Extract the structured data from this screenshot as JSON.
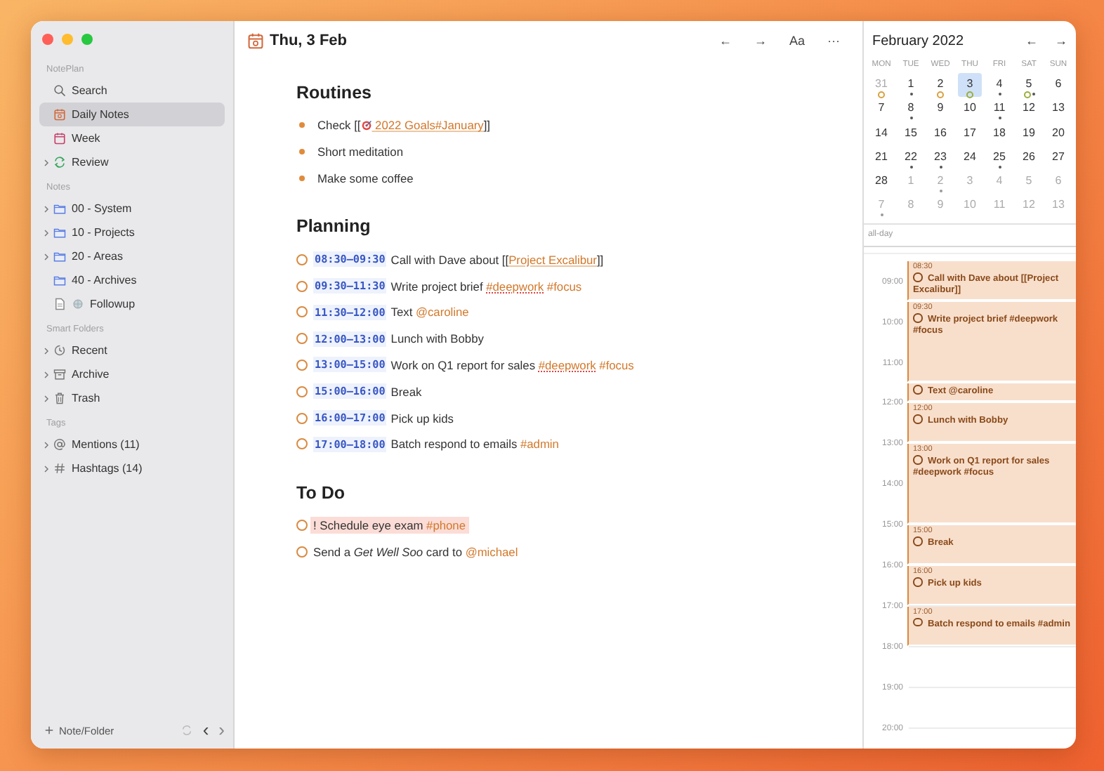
{
  "sidebar": {
    "sections": [
      {
        "heading": "NotePlan",
        "items": [
          {
            "label": "Search",
            "expandable": false,
            "selected": false
          },
          {
            "label": "Daily Notes",
            "expandable": false,
            "selected": true
          },
          {
            "label": "Week",
            "expandable": false,
            "selected": false
          },
          {
            "label": "Review",
            "expandable": true,
            "selected": false
          }
        ]
      },
      {
        "heading": "Notes",
        "items": [
          {
            "label": "00 - System",
            "expandable": true,
            "selected": false
          },
          {
            "label": "10 - Projects",
            "expandable": true,
            "selected": false
          },
          {
            "label": "20 - Areas",
            "expandable": true,
            "selected": false
          },
          {
            "label": "40 - Archives",
            "expandable": false,
            "selected": false
          },
          {
            "label": "Followup",
            "expandable": false,
            "selected": false
          }
        ]
      },
      {
        "heading": "Smart Folders",
        "items": [
          {
            "label": "Recent",
            "expandable": true,
            "selected": false
          },
          {
            "label": "Archive",
            "expandable": true,
            "selected": false
          },
          {
            "label": "Trash",
            "expandable": true,
            "selected": false
          }
        ]
      },
      {
        "heading": "Tags",
        "items": [
          {
            "label": "Mentions (11)",
            "expandable": true,
            "selected": false
          },
          {
            "label": "Hashtags (14)",
            "expandable": true,
            "selected": false
          }
        ]
      }
    ],
    "footer": {
      "add_label": "Note/Folder",
      "back": "‹",
      "forward": "›"
    }
  },
  "note": {
    "title": "Thu, 3 Feb",
    "toolbar": [
      "←",
      "→",
      "Aa",
      "···"
    ],
    "sections": [
      {
        "heading": "Routines",
        "items": [
          {
            "kind": "bullet",
            "segments": [
              {
                "kind": "plain",
                "text": "Check [["
              },
              {
                "kind": "icon"
              },
              {
                "kind": "link",
                "text": " 2022 Goals#January"
              },
              {
                "kind": "plain",
                "text": "]]"
              }
            ]
          },
          {
            "kind": "bullet",
            "segments": [
              {
                "kind": "plain",
                "text": "Short meditation"
              }
            ]
          },
          {
            "kind": "bullet",
            "segments": [
              {
                "kind": "plain",
                "text": "Make some coffee"
              }
            ]
          }
        ]
      },
      {
        "heading": "Planning",
        "items": [
          {
            "kind": "task",
            "checked": false,
            "time": "08:30–09:30",
            "segments": [
              {
                "kind": "plain",
                "text": "Call with Dave about [["
              },
              {
                "kind": "link",
                "text": "Project Excalibur"
              },
              {
                "kind": "plain",
                "text": "]]"
              }
            ]
          },
          {
            "kind": "task",
            "checked": false,
            "time": "09:30–11:30",
            "segments": [
              {
                "kind": "plain",
                "text": "Write project brief "
              },
              {
                "kind": "tag-spell",
                "text": "#deepwork"
              },
              {
                "kind": "tag",
                "text": " #focus"
              }
            ]
          },
          {
            "kind": "task",
            "checked": false,
            "time": "11:30–12:00",
            "segments": [
              {
                "kind": "plain",
                "text": "Text "
              },
              {
                "kind": "tag",
                "text": "@caroline"
              }
            ]
          },
          {
            "kind": "task",
            "checked": false,
            "time": "12:00–13:00",
            "segments": [
              {
                "kind": "plain",
                "text": "Lunch with Bobby"
              }
            ]
          },
          {
            "kind": "task",
            "checked": false,
            "time": "13:00–15:00",
            "segments": [
              {
                "kind": "plain",
                "text": "Work on Q1 report for sales "
              },
              {
                "kind": "tag-spell",
                "text": "#deepwork"
              },
              {
                "kind": "tag",
                "text": " #focus"
              }
            ]
          },
          {
            "kind": "task",
            "checked": false,
            "time": "15:00–16:00",
            "segments": [
              {
                "kind": "plain",
                "text": "Break"
              }
            ]
          },
          {
            "kind": "task",
            "checked": false,
            "time": "16:00–17:00",
            "segments": [
              {
                "kind": "plain",
                "text": "Pick up kids"
              }
            ]
          },
          {
            "kind": "task",
            "checked": false,
            "time": "17:00–18:00",
            "segments": [
              {
                "kind": "plain",
                "text": "Batch respond to emails "
              },
              {
                "kind": "tag",
                "text": "#admin"
              }
            ]
          }
        ]
      },
      {
        "heading": "To Do",
        "items": [
          {
            "kind": "task",
            "checked": false,
            "priority": true,
            "segments": [
              {
                "kind": "plain",
                "text": "! Schedule eye exam "
              },
              {
                "kind": "tag",
                "text": "#phone"
              }
            ]
          },
          {
            "kind": "task",
            "checked": false,
            "priority": false,
            "segments": [
              {
                "kind": "plain",
                "text": "Send a "
              },
              {
                "kind": "italic",
                "text": "Get Well Soo"
              },
              {
                "kind": "plain",
                "text": " card to "
              },
              {
                "kind": "tag",
                "text": "@michael"
              }
            ]
          }
        ]
      }
    ]
  },
  "calendar": {
    "month": "February 2022",
    "prev": "←",
    "next": "→",
    "weekdays": [
      "MON",
      "TUE",
      "WED",
      "THU",
      "FRI",
      "SAT",
      "SUN"
    ],
    "days": [
      {
        "label": "31",
        "muted": true,
        "selected": false,
        "marks": [
          {
            "kind": "ring",
            "color": "#d9a040"
          }
        ]
      },
      {
        "label": "1",
        "muted": false,
        "selected": false,
        "marks": [
          {
            "kind": "dot"
          }
        ]
      },
      {
        "label": "2",
        "muted": false,
        "selected": false,
        "marks": [
          {
            "kind": "ring",
            "color": "#d9a040"
          }
        ]
      },
      {
        "label": "3",
        "muted": false,
        "selected": true,
        "marks": [
          {
            "kind": "ring",
            "color": "#9aae3c"
          }
        ]
      },
      {
        "label": "4",
        "muted": false,
        "selected": false,
        "marks": [
          {
            "kind": "dot"
          }
        ]
      },
      {
        "label": "5",
        "muted": false,
        "selected": false,
        "marks": [
          {
            "kind": "ring",
            "color": "#9aae3c"
          },
          {
            "kind": "dot"
          }
        ]
      },
      {
        "label": "6",
        "muted": false,
        "selected": false
      },
      {
        "label": "7",
        "muted": false,
        "selected": false
      },
      {
        "label": "8",
        "muted": false,
        "selected": false,
        "marks": [
          {
            "kind": "dot"
          }
        ]
      },
      {
        "label": "9",
        "muted": false,
        "selected": false
      },
      {
        "label": "10",
        "muted": false,
        "selected": false
      },
      {
        "label": "11",
        "muted": false,
        "selected": false,
        "marks": [
          {
            "kind": "dot"
          }
        ]
      },
      {
        "label": "12",
        "muted": false,
        "selected": false
      },
      {
        "label": "13",
        "muted": false,
        "selected": false
      },
      {
        "label": "14",
        "muted": false,
        "selected": false
      },
      {
        "label": "15",
        "muted": false,
        "selected": false
      },
      {
        "label": "16",
        "muted": false,
        "selected": false
      },
      {
        "label": "17",
        "muted": false,
        "selected": false
      },
      {
        "label": "18",
        "muted": false,
        "selected": false
      },
      {
        "label": "19",
        "muted": false,
        "selected": false
      },
      {
        "label": "20",
        "muted": false,
        "selected": false
      },
      {
        "label": "21",
        "muted": false,
        "selected": false
      },
      {
        "label": "22",
        "muted": false,
        "selected": false,
        "marks": [
          {
            "kind": "dot"
          }
        ]
      },
      {
        "label": "23",
        "muted": false,
        "selected": false,
        "marks": [
          {
            "kind": "dot"
          }
        ]
      },
      {
        "label": "24",
        "muted": false,
        "selected": false
      },
      {
        "label": "25",
        "muted": false,
        "selected": false,
        "marks": [
          {
            "kind": "dot"
          }
        ]
      },
      {
        "label": "26",
        "muted": false,
        "selected": false
      },
      {
        "label": "27",
        "muted": false,
        "selected": false
      },
      {
        "label": "28",
        "muted": false,
        "selected": false
      },
      {
        "label": "1",
        "muted": true,
        "selected": false
      },
      {
        "label": "2",
        "muted": true,
        "selected": false,
        "marks": [
          {
            "kind": "dot"
          }
        ]
      },
      {
        "label": "3",
        "muted": true,
        "selected": false
      },
      {
        "label": "4",
        "muted": true,
        "selected": false
      },
      {
        "label": "5",
        "muted": true,
        "selected": false
      },
      {
        "label": "6",
        "muted": true,
        "selected": false
      },
      {
        "label": "7",
        "muted": true,
        "selected": false,
        "marks": [
          {
            "kind": "dot"
          }
        ]
      },
      {
        "label": "8",
        "muted": true,
        "selected": false
      },
      {
        "label": "9",
        "muted": true,
        "selected": false
      },
      {
        "label": "10",
        "muted": true,
        "selected": false
      },
      {
        "label": "11",
        "muted": true,
        "selected": false
      },
      {
        "label": "12",
        "muted": true,
        "selected": false
      },
      {
        "label": "13",
        "muted": true,
        "selected": false
      }
    ],
    "all_day_label": "all-day",
    "hours": [
      "09:00",
      "10:00",
      "11:00",
      "12:00",
      "13:00",
      "14:00",
      "15:00",
      "16:00",
      "17:00",
      "18:00",
      "19:00",
      "20:00"
    ],
    "events": [
      {
        "time": "08:30",
        "title": "Call with Dave about [[Project Excalibur]]"
      },
      {
        "time": "09:30",
        "title": "Write project brief #deepwork #focus"
      },
      {
        "title": "Text @caroline"
      },
      {
        "time": "12:00",
        "title": "Lunch with Bobby"
      },
      {
        "time": "13:00",
        "title": "Work on Q1 report for sales #deepwork #focus"
      },
      {
        "time": "15:00",
        "title": "Break"
      },
      {
        "time": "16:00",
        "title": "Pick up kids"
      },
      {
        "time": "17:00",
        "title": "Batch respond to emails #admin"
      }
    ]
  }
}
